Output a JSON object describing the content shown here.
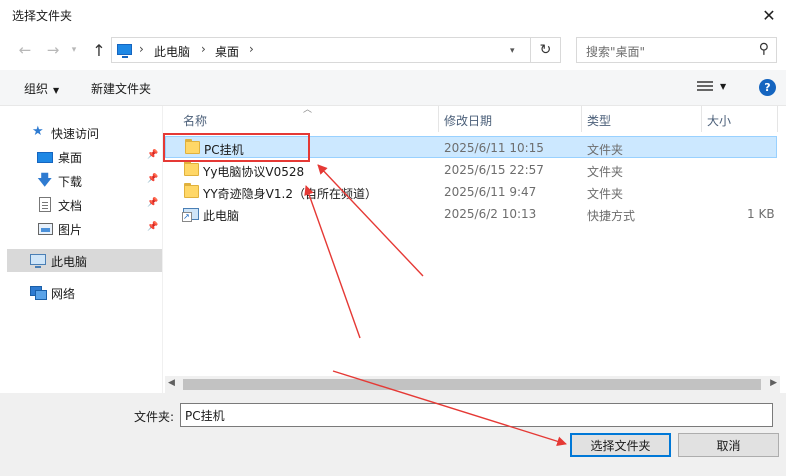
{
  "dialog": {
    "title": "选择文件夹"
  },
  "address": {
    "items": [
      "此电脑",
      "桌面"
    ]
  },
  "search": {
    "placeholder": "搜索\"桌面\""
  },
  "toolbar": {
    "organize": "组织",
    "new_folder": "新建文件夹",
    "help": "?"
  },
  "navpane": {
    "quick_access": "快速访问",
    "items": [
      {
        "label": "桌面",
        "icon": "desktop-icon",
        "pinned": true
      },
      {
        "label": "下载",
        "icon": "download-icon",
        "pinned": true
      },
      {
        "label": "文档",
        "icon": "document-icon",
        "pinned": true
      },
      {
        "label": "图片",
        "icon": "picture-icon",
        "pinned": true
      }
    ],
    "this_pc": "此电脑",
    "network": "网络"
  },
  "columns": {
    "name": "名称",
    "date": "修改日期",
    "type": "类型",
    "size": "大小"
  },
  "files": [
    {
      "name": "PC挂机",
      "date": "2025/6/11 10:15",
      "type": "文件夹",
      "size": "",
      "icon": "folder-icon",
      "selected": true
    },
    {
      "name": "Yy电脑协议V0528",
      "date": "2025/6/15 22:57",
      "type": "文件夹",
      "size": "",
      "icon": "folder-icon",
      "selected": false
    },
    {
      "name": "YY奇迹隐身V1.2（自所在频道）",
      "date": "2025/6/11 9:47",
      "type": "文件夹",
      "size": "",
      "icon": "folder-icon",
      "selected": false
    },
    {
      "name": "此电脑",
      "date": "2025/6/2 10:13",
      "type": "快捷方式",
      "size": "1 KB",
      "icon": "shortcut-icon",
      "selected": false
    }
  ],
  "footer": {
    "folder_label": "文件夹:",
    "folder_value": "PC挂机",
    "select_button": "选择文件夹",
    "cancel_button": "取消"
  },
  "colors": {
    "annotation": "#e53935",
    "selection": "#cce8ff",
    "accent": "#0078d7"
  }
}
